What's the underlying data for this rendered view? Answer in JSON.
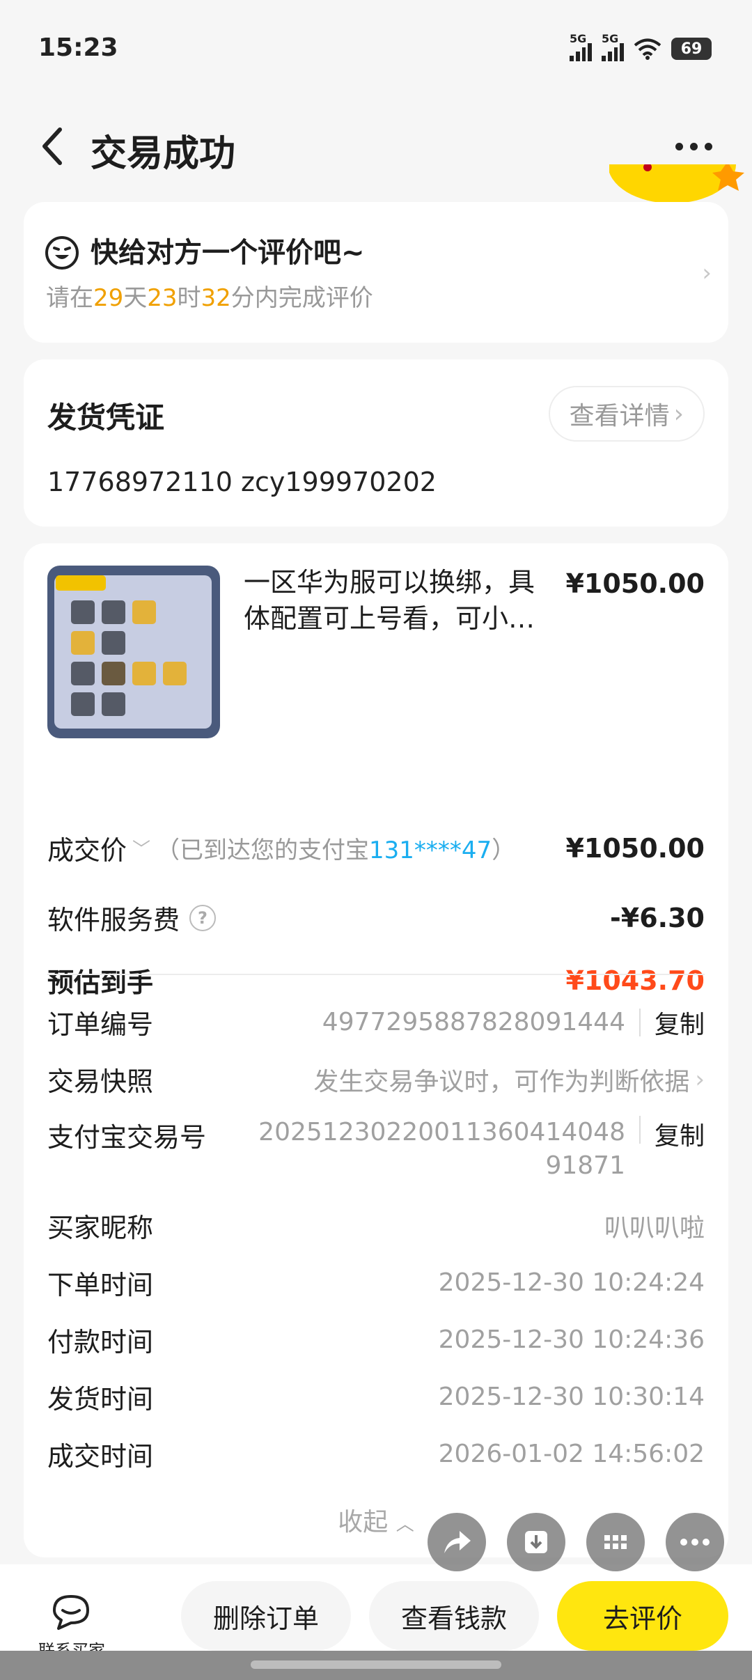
{
  "status_bar": {
    "time": "15:23",
    "signal_1": "5G",
    "signal_2": "5G",
    "battery": "69"
  },
  "nav": {
    "title": "交易成功"
  },
  "review_card": {
    "heading": "快给对方一个评价吧~",
    "prefix": "请在",
    "days": "29",
    "days_unit": "天",
    "hours": "23",
    "hours_unit": "时",
    "minutes": "32",
    "minutes_unit": "分内完成评价"
  },
  "proof_card": {
    "heading": "发货凭证",
    "detail_button": "查看详情",
    "value": "17768972110 zcy199970202"
  },
  "goods": {
    "title": "一区华为服可以换绑，具体配置可上号看，可小…",
    "price": "¥1050.00"
  },
  "summary": {
    "deal_price_label": "成交价",
    "deal_note_prefix": "（已到达您的支付宝",
    "deal_note_account": "131****47",
    "deal_note_suffix": "）",
    "deal_price": "¥1050.00",
    "service_fee_label": "软件服务费",
    "service_fee": "-¥6.30",
    "estimate_label": "预估到手",
    "estimate": "¥1043.70"
  },
  "order_info": {
    "order_no_label": "订单编号",
    "order_no": "4977295887828091444",
    "copy_label": "复制",
    "snapshot_label": "交易快照",
    "snapshot_value": "发生交易争议时，可作为判断依据",
    "alipay_label": "支付宝交易号",
    "alipay_line1": "20251230220011360414048",
    "alipay_line2": "91871",
    "buyer_label": "买家昵称",
    "buyer": "叭叭叭啦",
    "order_time_label": "下单时间",
    "order_time": "2025-12-30 10:24:24",
    "pay_time_label": "付款时间",
    "pay_time": "2025-12-30 10:24:36",
    "ship_time_label": "发货时间",
    "ship_time": "2025-12-30 10:30:14",
    "deal_time_label": "成交时间",
    "deal_time": "2026-01-02 14:56:02",
    "collapse": "收起"
  },
  "bottom": {
    "contact": "联系买家",
    "delete": "删除订单",
    "view_money": "查看钱款",
    "rate": "去评价"
  },
  "icons": [
    "back-icon",
    "more-icon",
    "smiley-icon",
    "chevron-right-icon",
    "help-icon",
    "chevron-down-icon",
    "chevron-up-icon",
    "chat-icon",
    "share-icon",
    "download-icon",
    "grid-icon",
    "dots-icon"
  ],
  "colors": {
    "accent_yellow": "#ffe60f",
    "countdown": "#f0a000",
    "price_red": "#ff4a1a",
    "account_blue": "#1aaef0"
  }
}
